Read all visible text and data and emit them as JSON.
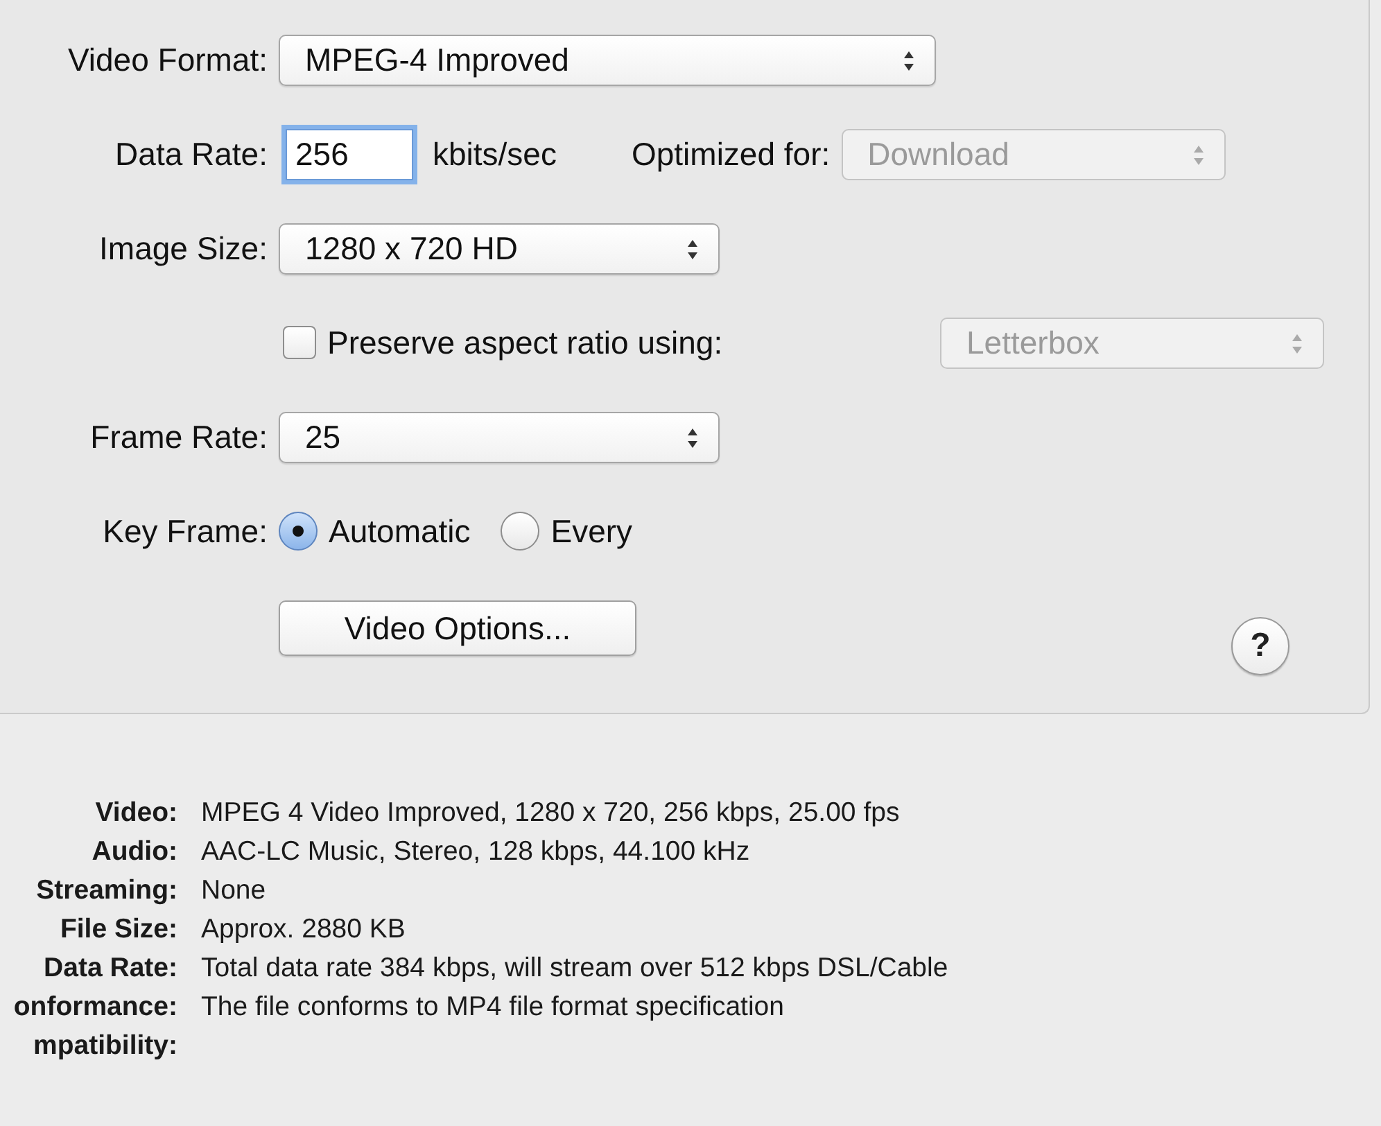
{
  "video_format": {
    "label": "Video Format:",
    "value": "MPEG-4 Improved",
    "disabled": false
  },
  "data_rate": {
    "label": "Data Rate:",
    "value": "256",
    "unit": "kbits/sec",
    "focused": true
  },
  "optimized_for": {
    "label": "Optimized for:",
    "value": "Download",
    "disabled": true
  },
  "image_size": {
    "label": "Image Size:",
    "value": "1280 x 720 HD",
    "disabled": false
  },
  "preserve_aspect": {
    "label": "Preserve aspect ratio using:",
    "checked": false
  },
  "aspect_mode": {
    "value": "Letterbox",
    "disabled": true
  },
  "frame_rate": {
    "label": "Frame Rate:",
    "value": "25",
    "disabled": false
  },
  "key_frame": {
    "label": "Key Frame:",
    "options": [
      {
        "label": "Automatic",
        "selected": true
      },
      {
        "label": "Every",
        "selected": false
      }
    ]
  },
  "video_options_button": "Video Options...",
  "help_button": "?",
  "summary": [
    {
      "label": "Video:",
      "value": "MPEG 4 Video Improved, 1280 x 720, 256 kbps, 25.00 fps"
    },
    {
      "label": "Audio:",
      "value": "AAC-LC Music, Stereo, 128 kbps, 44.100 kHz"
    },
    {
      "label": "Streaming:",
      "value": "None"
    },
    {
      "label": "File Size:",
      "value": "Approx. 2880 KB"
    },
    {
      "label": "Data Rate:",
      "value": "Total data rate 384 kbps, will stream over 512 kbps DSL/Cable"
    },
    {
      "label": "onformance:",
      "value": "The file conforms to MP4 file format specification"
    },
    {
      "label": "mpatibility:"
    }
  ]
}
